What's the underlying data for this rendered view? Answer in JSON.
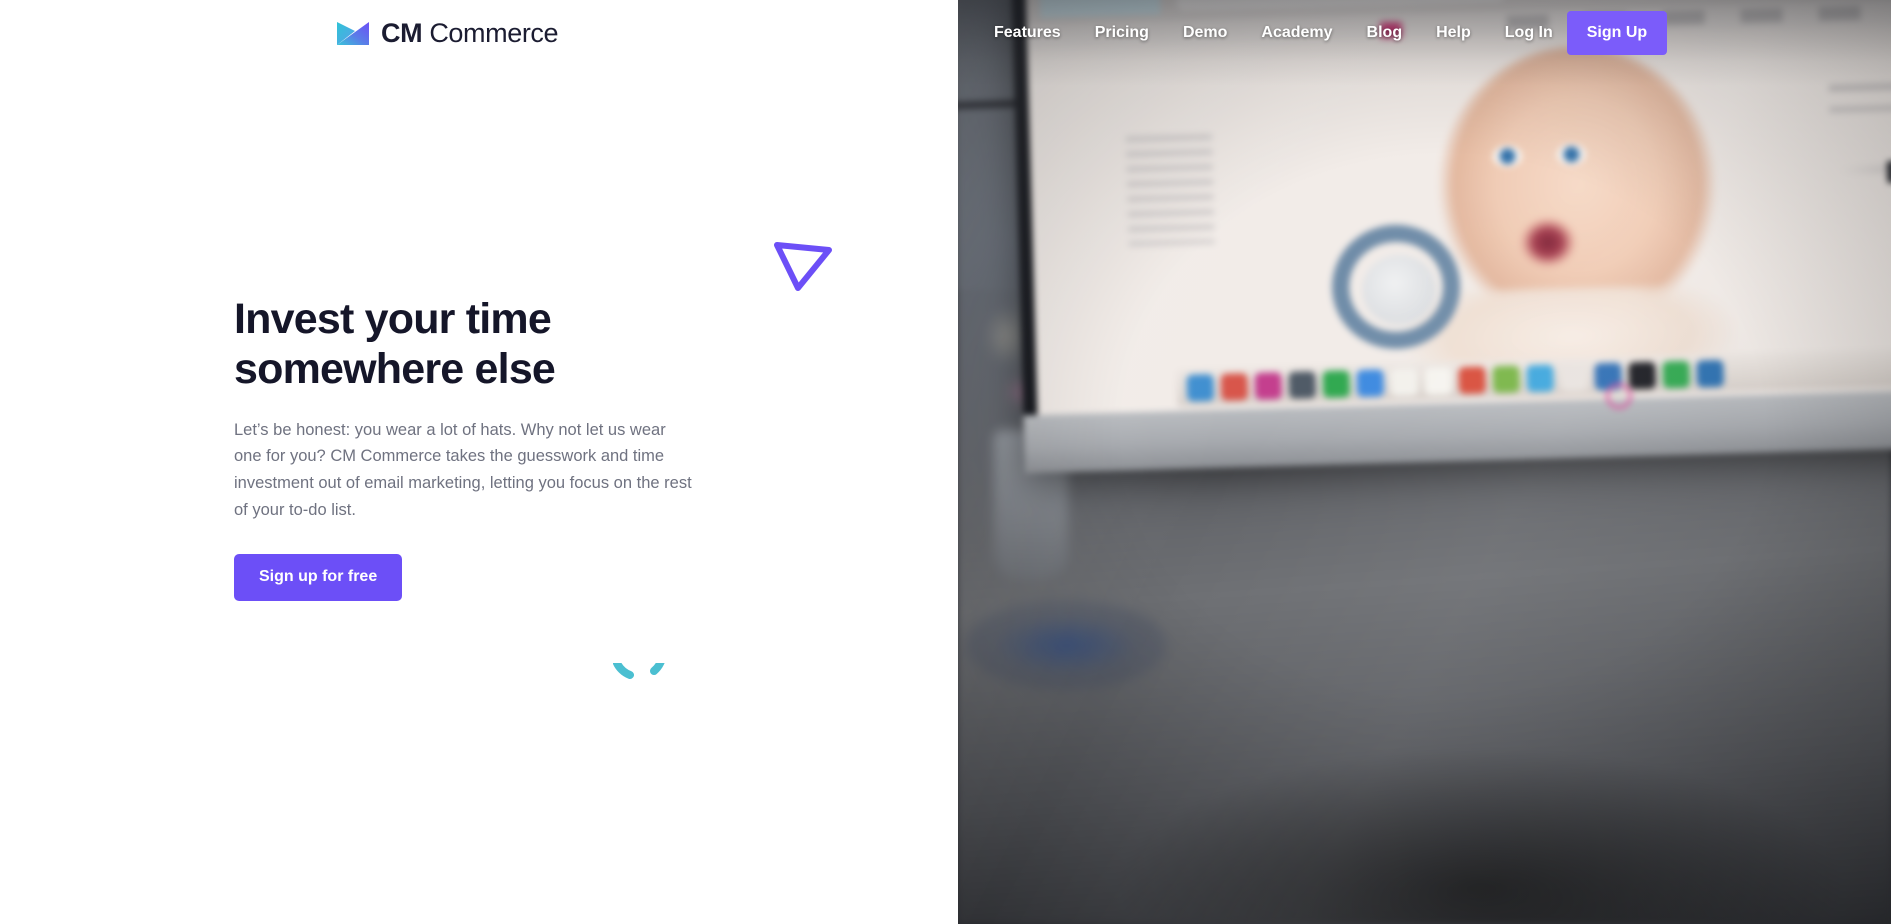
{
  "brand": {
    "name_bold": "CM",
    "name_light": "Commerce",
    "logo_icon": "cm-commerce-gradient-mark",
    "logo_gradient_start": "#3ec6d8",
    "logo_gradient_end": "#6c4ff7"
  },
  "nav": {
    "items": [
      {
        "label": "Features",
        "name": "nav-link-features"
      },
      {
        "label": "Pricing",
        "name": "nav-link-pricing"
      },
      {
        "label": "Demo",
        "name": "nav-link-demo"
      },
      {
        "label": "Academy",
        "name": "nav-link-academy"
      },
      {
        "label": "Blog",
        "name": "nav-link-blog"
      },
      {
        "label": "Help",
        "name": "nav-link-help"
      },
      {
        "label": "Log In",
        "name": "nav-link-log-in"
      }
    ],
    "signup_label": "Sign Up",
    "signup_color": "#7b5cfa",
    "link_color": "#ffffff"
  },
  "hero": {
    "title_line1": "Invest your time",
    "title_line2": "somewhere else",
    "paragraph": "Let’s be honest: you wear a lot of hats. Why not let us wear one for you? CM Commerce takes the guesswork and time investment out of email marketing, letting you focus on the rest of your to-do list.",
    "cta_label": "Sign up for free",
    "cta_color": "#6c4ff7",
    "title_color": "#151629",
    "paragraph_color": "#6f7280"
  },
  "decorations": {
    "triangle_icon": "outlined-down-triangle",
    "triangle_color": "#6c4ff7",
    "spinner_icon": "loading-spinner-arc",
    "spinner_color": "#4bbfd1"
  },
  "photo": {
    "alt_name": "blurred-imac-desk-photo",
    "dock_icon_colors": [
      "#3f8fd0",
      "#d8554a",
      "#c43f8e",
      "#4f5a66",
      "#e7e7e7",
      "#3d8ae0",
      "#f3f1ec",
      "#f6f4ef",
      "#d94f3d",
      "#7ab648",
      "#3fa7dd",
      "#e9e3df",
      "#2f6fb5",
      "#1b1c22",
      "#2fa84f",
      "#2a6fb0"
    ],
    "pink_note_color": "#d6246f",
    "magenta_ring_color": "#e24ba0"
  }
}
